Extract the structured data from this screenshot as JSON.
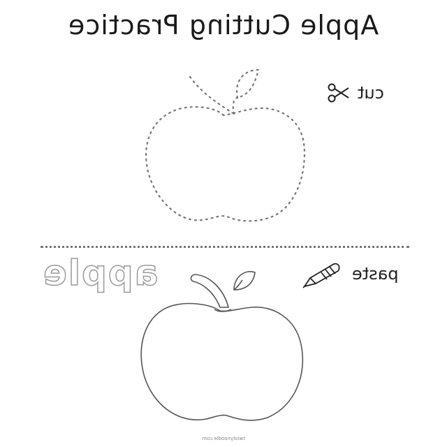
{
  "title": "Apple Cutting Practice",
  "cut_label": "cut",
  "paste_label": "paste",
  "word": "apple",
  "footer": "twistynoodle.com",
  "icons": {
    "cut": "scissors-icon",
    "paste": "glue-bottle-icon"
  }
}
